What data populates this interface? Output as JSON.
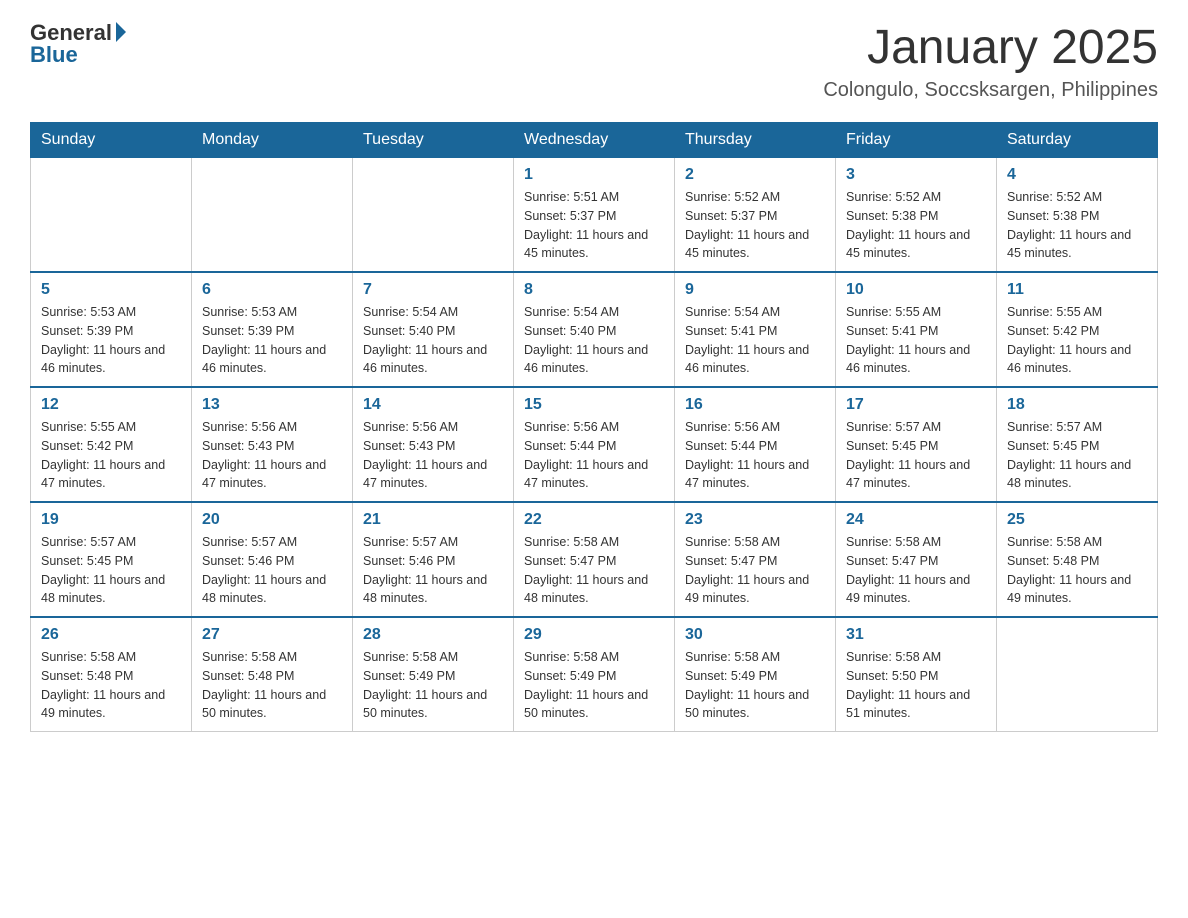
{
  "header": {
    "logo_general": "General",
    "logo_blue": "Blue",
    "title": "January 2025",
    "subtitle": "Colongulo, Soccsksargen, Philippines"
  },
  "days_of_week": [
    "Sunday",
    "Monday",
    "Tuesday",
    "Wednesday",
    "Thursday",
    "Friday",
    "Saturday"
  ],
  "weeks": [
    {
      "days": [
        {
          "number": "",
          "info": ""
        },
        {
          "number": "",
          "info": ""
        },
        {
          "number": "",
          "info": ""
        },
        {
          "number": "1",
          "info": "Sunrise: 5:51 AM\nSunset: 5:37 PM\nDaylight: 11 hours and 45 minutes."
        },
        {
          "number": "2",
          "info": "Sunrise: 5:52 AM\nSunset: 5:37 PM\nDaylight: 11 hours and 45 minutes."
        },
        {
          "number": "3",
          "info": "Sunrise: 5:52 AM\nSunset: 5:38 PM\nDaylight: 11 hours and 45 minutes."
        },
        {
          "number": "4",
          "info": "Sunrise: 5:52 AM\nSunset: 5:38 PM\nDaylight: 11 hours and 45 minutes."
        }
      ]
    },
    {
      "days": [
        {
          "number": "5",
          "info": "Sunrise: 5:53 AM\nSunset: 5:39 PM\nDaylight: 11 hours and 46 minutes."
        },
        {
          "number": "6",
          "info": "Sunrise: 5:53 AM\nSunset: 5:39 PM\nDaylight: 11 hours and 46 minutes."
        },
        {
          "number": "7",
          "info": "Sunrise: 5:54 AM\nSunset: 5:40 PM\nDaylight: 11 hours and 46 minutes."
        },
        {
          "number": "8",
          "info": "Sunrise: 5:54 AM\nSunset: 5:40 PM\nDaylight: 11 hours and 46 minutes."
        },
        {
          "number": "9",
          "info": "Sunrise: 5:54 AM\nSunset: 5:41 PM\nDaylight: 11 hours and 46 minutes."
        },
        {
          "number": "10",
          "info": "Sunrise: 5:55 AM\nSunset: 5:41 PM\nDaylight: 11 hours and 46 minutes."
        },
        {
          "number": "11",
          "info": "Sunrise: 5:55 AM\nSunset: 5:42 PM\nDaylight: 11 hours and 46 minutes."
        }
      ]
    },
    {
      "days": [
        {
          "number": "12",
          "info": "Sunrise: 5:55 AM\nSunset: 5:42 PM\nDaylight: 11 hours and 47 minutes."
        },
        {
          "number": "13",
          "info": "Sunrise: 5:56 AM\nSunset: 5:43 PM\nDaylight: 11 hours and 47 minutes."
        },
        {
          "number": "14",
          "info": "Sunrise: 5:56 AM\nSunset: 5:43 PM\nDaylight: 11 hours and 47 minutes."
        },
        {
          "number": "15",
          "info": "Sunrise: 5:56 AM\nSunset: 5:44 PM\nDaylight: 11 hours and 47 minutes."
        },
        {
          "number": "16",
          "info": "Sunrise: 5:56 AM\nSunset: 5:44 PM\nDaylight: 11 hours and 47 minutes."
        },
        {
          "number": "17",
          "info": "Sunrise: 5:57 AM\nSunset: 5:45 PM\nDaylight: 11 hours and 47 minutes."
        },
        {
          "number": "18",
          "info": "Sunrise: 5:57 AM\nSunset: 5:45 PM\nDaylight: 11 hours and 48 minutes."
        }
      ]
    },
    {
      "days": [
        {
          "number": "19",
          "info": "Sunrise: 5:57 AM\nSunset: 5:45 PM\nDaylight: 11 hours and 48 minutes."
        },
        {
          "number": "20",
          "info": "Sunrise: 5:57 AM\nSunset: 5:46 PM\nDaylight: 11 hours and 48 minutes."
        },
        {
          "number": "21",
          "info": "Sunrise: 5:57 AM\nSunset: 5:46 PM\nDaylight: 11 hours and 48 minutes."
        },
        {
          "number": "22",
          "info": "Sunrise: 5:58 AM\nSunset: 5:47 PM\nDaylight: 11 hours and 48 minutes."
        },
        {
          "number": "23",
          "info": "Sunrise: 5:58 AM\nSunset: 5:47 PM\nDaylight: 11 hours and 49 minutes."
        },
        {
          "number": "24",
          "info": "Sunrise: 5:58 AM\nSunset: 5:47 PM\nDaylight: 11 hours and 49 minutes."
        },
        {
          "number": "25",
          "info": "Sunrise: 5:58 AM\nSunset: 5:48 PM\nDaylight: 11 hours and 49 minutes."
        }
      ]
    },
    {
      "days": [
        {
          "number": "26",
          "info": "Sunrise: 5:58 AM\nSunset: 5:48 PM\nDaylight: 11 hours and 49 minutes."
        },
        {
          "number": "27",
          "info": "Sunrise: 5:58 AM\nSunset: 5:48 PM\nDaylight: 11 hours and 50 minutes."
        },
        {
          "number": "28",
          "info": "Sunrise: 5:58 AM\nSunset: 5:49 PM\nDaylight: 11 hours and 50 minutes."
        },
        {
          "number": "29",
          "info": "Sunrise: 5:58 AM\nSunset: 5:49 PM\nDaylight: 11 hours and 50 minutes."
        },
        {
          "number": "30",
          "info": "Sunrise: 5:58 AM\nSunset: 5:49 PM\nDaylight: 11 hours and 50 minutes."
        },
        {
          "number": "31",
          "info": "Sunrise: 5:58 AM\nSunset: 5:50 PM\nDaylight: 11 hours and 51 minutes."
        },
        {
          "number": "",
          "info": ""
        }
      ]
    }
  ]
}
